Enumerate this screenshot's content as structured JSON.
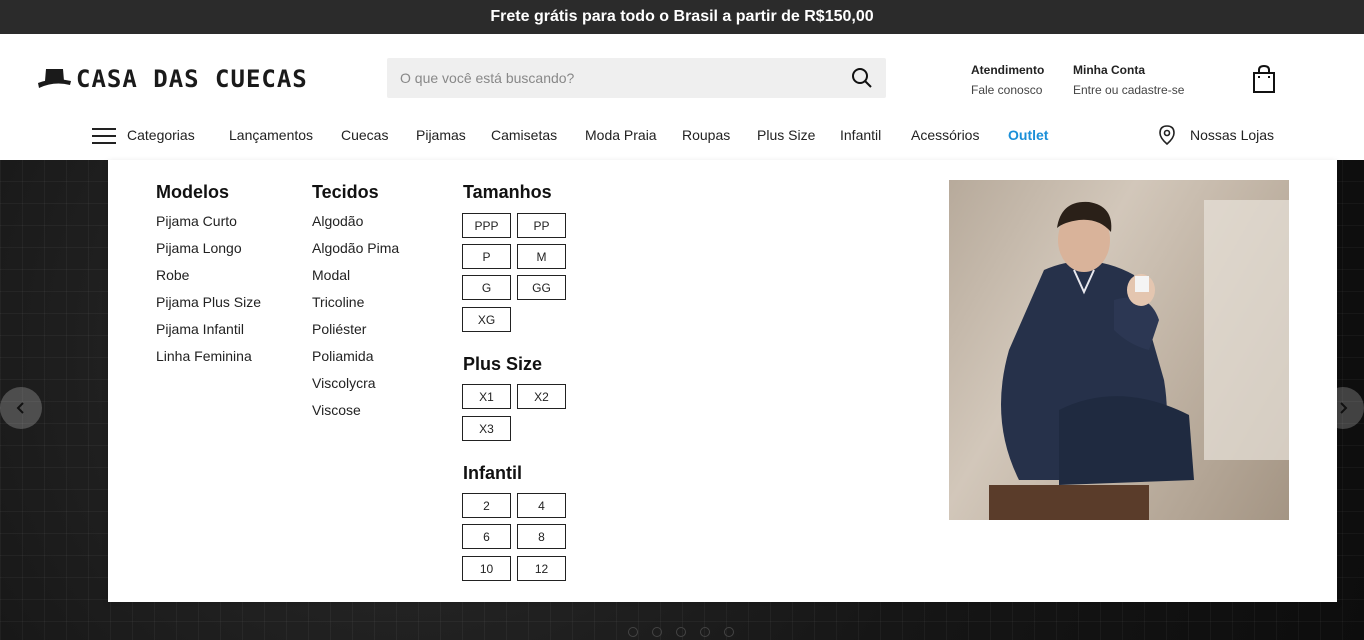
{
  "topbar": {
    "text": "Frete grátis para todo o Brasil a partir de R$150,00"
  },
  "brand": {
    "logo_text": "CASA DAS CUECAS"
  },
  "search": {
    "placeholder": "O que você está buscando?"
  },
  "header_links": {
    "service_title": "Atendimento",
    "service_sub": "Fale conosco",
    "account_title": "Minha Conta",
    "account_sub": "Entre ou cadastre-se"
  },
  "nav": {
    "categories_label": "Categorias",
    "items": [
      "Lançamentos",
      "Cuecas",
      "Pijamas",
      "Camisetas",
      "Moda Praia",
      "Roupas",
      "Plus Size",
      "Infantil",
      "Acessórios",
      "Outlet"
    ],
    "stores_label": "Nossas Lojas"
  },
  "mega_menu": {
    "modelos": {
      "title": "Modelos",
      "items": [
        "Pijama Curto",
        "Pijama Longo",
        "Robe",
        "Pijama Plus Size",
        "Pijama Infantil",
        "Linha Feminina"
      ]
    },
    "tecidos": {
      "title": "Tecidos",
      "items": [
        "Algodão",
        "Algodão Pima",
        "Modal",
        "Tricoline",
        "Poliéster",
        "Poliamida",
        "Viscolycra",
        "Viscose"
      ]
    },
    "tamanhos": {
      "title": "Tamanhos",
      "items": [
        "PPP",
        "PP",
        "P",
        "M",
        "G",
        "GG",
        "XG"
      ]
    },
    "plus_size": {
      "title": "Plus Size",
      "items": [
        "X1",
        "X2",
        "X3"
      ]
    },
    "infantil": {
      "title": "Infantil",
      "items": [
        "2",
        "4",
        "6",
        "8",
        "10",
        "12"
      ]
    }
  },
  "colors": {
    "topbar_bg": "#2b2b2b",
    "accent": "#1a8fd8",
    "search_bg": "#efefef"
  },
  "icons": [
    "hat-logo-icon",
    "search-icon",
    "shopping-bag-icon",
    "hamburger-menu-icon",
    "map-pin-icon",
    "chevron-left-icon",
    "chevron-right-icon"
  ]
}
